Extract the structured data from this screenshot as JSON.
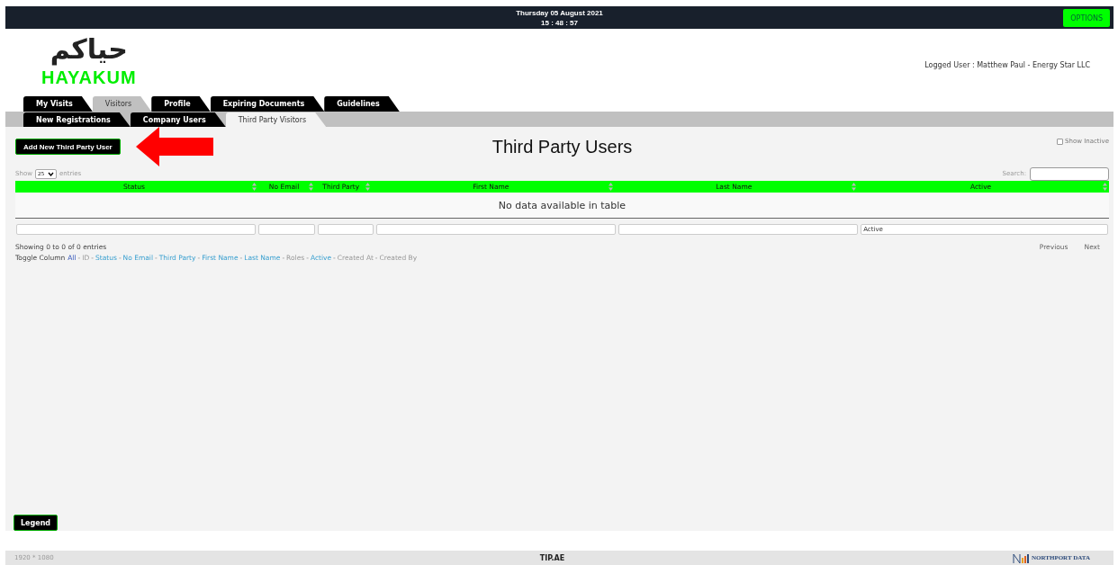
{
  "top_bar": {
    "date": "Thursday 05 August 2021",
    "time": "15 : 48 : 57",
    "options_button": "OPTIONS"
  },
  "logo": {
    "arabic": "حياكم",
    "latin": "HAYAKUM"
  },
  "logged_user": "Logged User : Matthew Paul - Energy Star LLC",
  "tabs": [
    {
      "label": "My Visits",
      "selected": false
    },
    {
      "label": "Visitors",
      "selected": true
    },
    {
      "label": "Profile",
      "selected": false
    },
    {
      "label": "Expiring Documents",
      "selected": false
    },
    {
      "label": "Guidelines",
      "selected": false
    }
  ],
  "subtabs": [
    {
      "label": "New Registrations",
      "selected": false
    },
    {
      "label": "Company Users",
      "selected": false
    },
    {
      "label": "Third Party Visitors",
      "selected": true
    }
  ],
  "add_button": "Add New Third Party User",
  "page_title": "Third Party Users",
  "show_inactive": {
    "label": "Show Inactive",
    "checked": false
  },
  "length": {
    "before": "Show",
    "value": "25",
    "after": "entries"
  },
  "search": {
    "label": "Search:"
  },
  "table": {
    "columns": [
      {
        "label": "Status"
      },
      {
        "label": "No Email"
      },
      {
        "label": "Third Party"
      },
      {
        "label": "First Name"
      },
      {
        "label": "Last Name"
      },
      {
        "label": "Active"
      }
    ],
    "empty": "No data available in table",
    "active_filter": "Active"
  },
  "info": "Showing 0 to 0 of 0 entries",
  "pagination": [
    "Previous",
    "Next"
  ],
  "toggle": {
    "label": "Toggle Column",
    "all": "All",
    "separator": "-",
    "items": [
      {
        "label": "ID",
        "on": false
      },
      {
        "label": "Status",
        "on": true
      },
      {
        "label": "No Email",
        "on": true
      },
      {
        "label": "Third Party",
        "on": true
      },
      {
        "label": "First Name",
        "on": true
      },
      {
        "label": "Last Name",
        "on": true
      },
      {
        "label": "Roles",
        "on": false
      },
      {
        "label": "Active",
        "on": true
      },
      {
        "label": "Created At",
        "on": false
      },
      {
        "label": "Created By",
        "on": false
      }
    ]
  },
  "legend_button": "Legend",
  "footer": {
    "resolution": "1920 * 1080",
    "site": "TIP.AE",
    "brand": "NORTHPORT DATA"
  }
}
